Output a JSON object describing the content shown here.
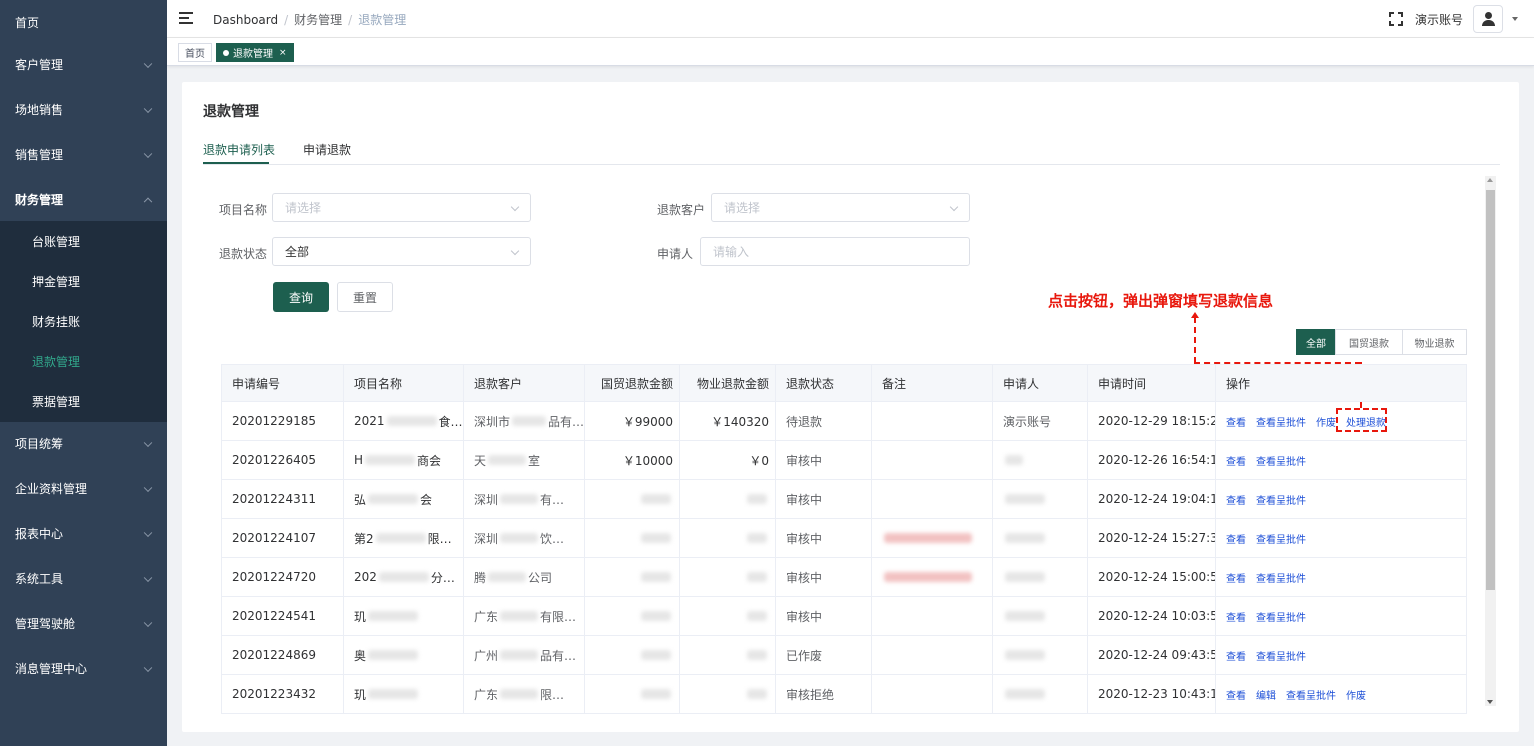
{
  "sidebar": {
    "items": [
      {
        "label": "首页"
      },
      {
        "label": "客户管理"
      },
      {
        "label": "场地销售"
      },
      {
        "label": "销售管理"
      },
      {
        "label": "财务管理"
      },
      {
        "label": "项目统筹"
      },
      {
        "label": "企业资料管理"
      },
      {
        "label": "报表中心"
      },
      {
        "label": "系统工具"
      },
      {
        "label": "管理驾驶舱"
      },
      {
        "label": "消息管理中心"
      }
    ],
    "finance_sub": [
      {
        "label": "台账管理"
      },
      {
        "label": "押金管理"
      },
      {
        "label": "财务挂账"
      },
      {
        "label": "退款管理"
      },
      {
        "label": "票据管理"
      }
    ]
  },
  "topbar": {
    "breadcrumb": [
      "Dashboard",
      "财务管理",
      "退款管理"
    ],
    "account_name": "演示账号",
    "icons": [
      "hamburger-icon",
      "fullscreen-icon",
      "user-icon",
      "caret-down-icon"
    ]
  },
  "tags": [
    {
      "label": "首页"
    },
    {
      "label": "退款管理",
      "close": "×"
    }
  ],
  "page": {
    "title": "退款管理",
    "tabs": [
      {
        "label": "退款申请列表"
      },
      {
        "label": "申请退款"
      }
    ]
  },
  "filters": {
    "project_label": "项目名称",
    "project_placeholder": "请选择",
    "customer_label": "退款客户",
    "customer_placeholder": "请选择",
    "status_label": "退款状态",
    "status_value": "全部",
    "applicant_label": "申请人",
    "applicant_placeholder": "请输入",
    "query_button": "查询",
    "reset_button": "重置"
  },
  "annotation": {
    "text": "点击按钮，弹出弹窗填写退款信息"
  },
  "segments": [
    {
      "label": "全部"
    },
    {
      "label": "国贸退款"
    },
    {
      "label": "物业退款"
    }
  ],
  "table": {
    "headers": [
      "申请编号",
      "项目名称",
      "退款客户",
      "国贸退款金额",
      "物业退款金额",
      "退款状态",
      "备注",
      "申请人",
      "申请时间",
      "操作"
    ],
    "rows": [
      {
        "id": "20201229185",
        "project": "2021",
        "project_tail": "食…",
        "customer": "深圳市",
        "customer_tail": "品有…",
        "gm_amount": "￥99000",
        "wy_amount": "￥140320",
        "status": "待退款",
        "applicant": "演示账号",
        "time": "2020-12-29 18:15:25",
        "ops": [
          "查看",
          "查看呈批件",
          "作废",
          "处理退款"
        ]
      },
      {
        "id": "20201226405",
        "project": "H",
        "project_tail": "商会",
        "customer": "天",
        "customer_tail": "室",
        "gm_amount": "￥10000",
        "wy_amount": "￥0",
        "status": "审核中",
        "applicant": "",
        "time": "2020-12-26 16:54:15",
        "ops": [
          "查看",
          "查看呈批件"
        ]
      },
      {
        "id": "20201224311",
        "project": "弘",
        "project_tail": "会",
        "customer": "深圳",
        "customer_tail": "有…",
        "gm_amount": "",
        "wy_amount": "",
        "status": "审核中",
        "applicant": "",
        "time": "2020-12-24 19:04:19",
        "ops": [
          "查看",
          "查看呈批件"
        ]
      },
      {
        "id": "20201224107",
        "project": "第2",
        "project_tail": "限…",
        "customer": "深圳",
        "customer_tail": "饮…",
        "gm_amount": "",
        "wy_amount": "",
        "status": "审核中",
        "applicant": "",
        "time": "2020-12-24 15:27:33",
        "ops": [
          "查看",
          "查看呈批件"
        ]
      },
      {
        "id": "20201224720",
        "project": "202",
        "project_tail": "分…",
        "customer": "腾",
        "customer_tail": "公司",
        "gm_amount": "",
        "wy_amount": "",
        "status": "审核中",
        "applicant": "",
        "time": "2020-12-24 15:00:51",
        "ops": [
          "查看",
          "查看呈批件"
        ]
      },
      {
        "id": "20201224541",
        "project": "玑",
        "project_tail": "",
        "customer": "广东",
        "customer_tail": "有限…",
        "gm_amount": "",
        "wy_amount": "",
        "status": "审核中",
        "applicant": "",
        "time": "2020-12-24 10:03:59",
        "ops": [
          "查看",
          "查看呈批件"
        ]
      },
      {
        "id": "20201224869",
        "project": "奥",
        "project_tail": "",
        "customer": "广州",
        "customer_tail": "品有…",
        "gm_amount": "",
        "wy_amount": "",
        "status": "已作废",
        "applicant": "",
        "time": "2020-12-24 09:43:50",
        "ops": [
          "查看",
          "查看呈批件"
        ]
      },
      {
        "id": "20201223432",
        "project": "玑",
        "project_tail": "",
        "customer": "广东",
        "customer_tail": "限…",
        "gm_amount": "",
        "wy_amount": "",
        "status": "审核拒绝",
        "applicant": "",
        "time": "2020-12-23 10:43:16",
        "ops": [
          "查看",
          "编辑",
          "查看呈批件",
          "作废"
        ]
      }
    ]
  },
  "colors": {
    "sidebar_bg": "#304156",
    "sidebar_sub_bg": "#1f2d3d",
    "primary": "#1d5f4f",
    "active_menu_text": "#32a88c",
    "link": "#1d4fd7",
    "annotation": "#e8170c"
  }
}
